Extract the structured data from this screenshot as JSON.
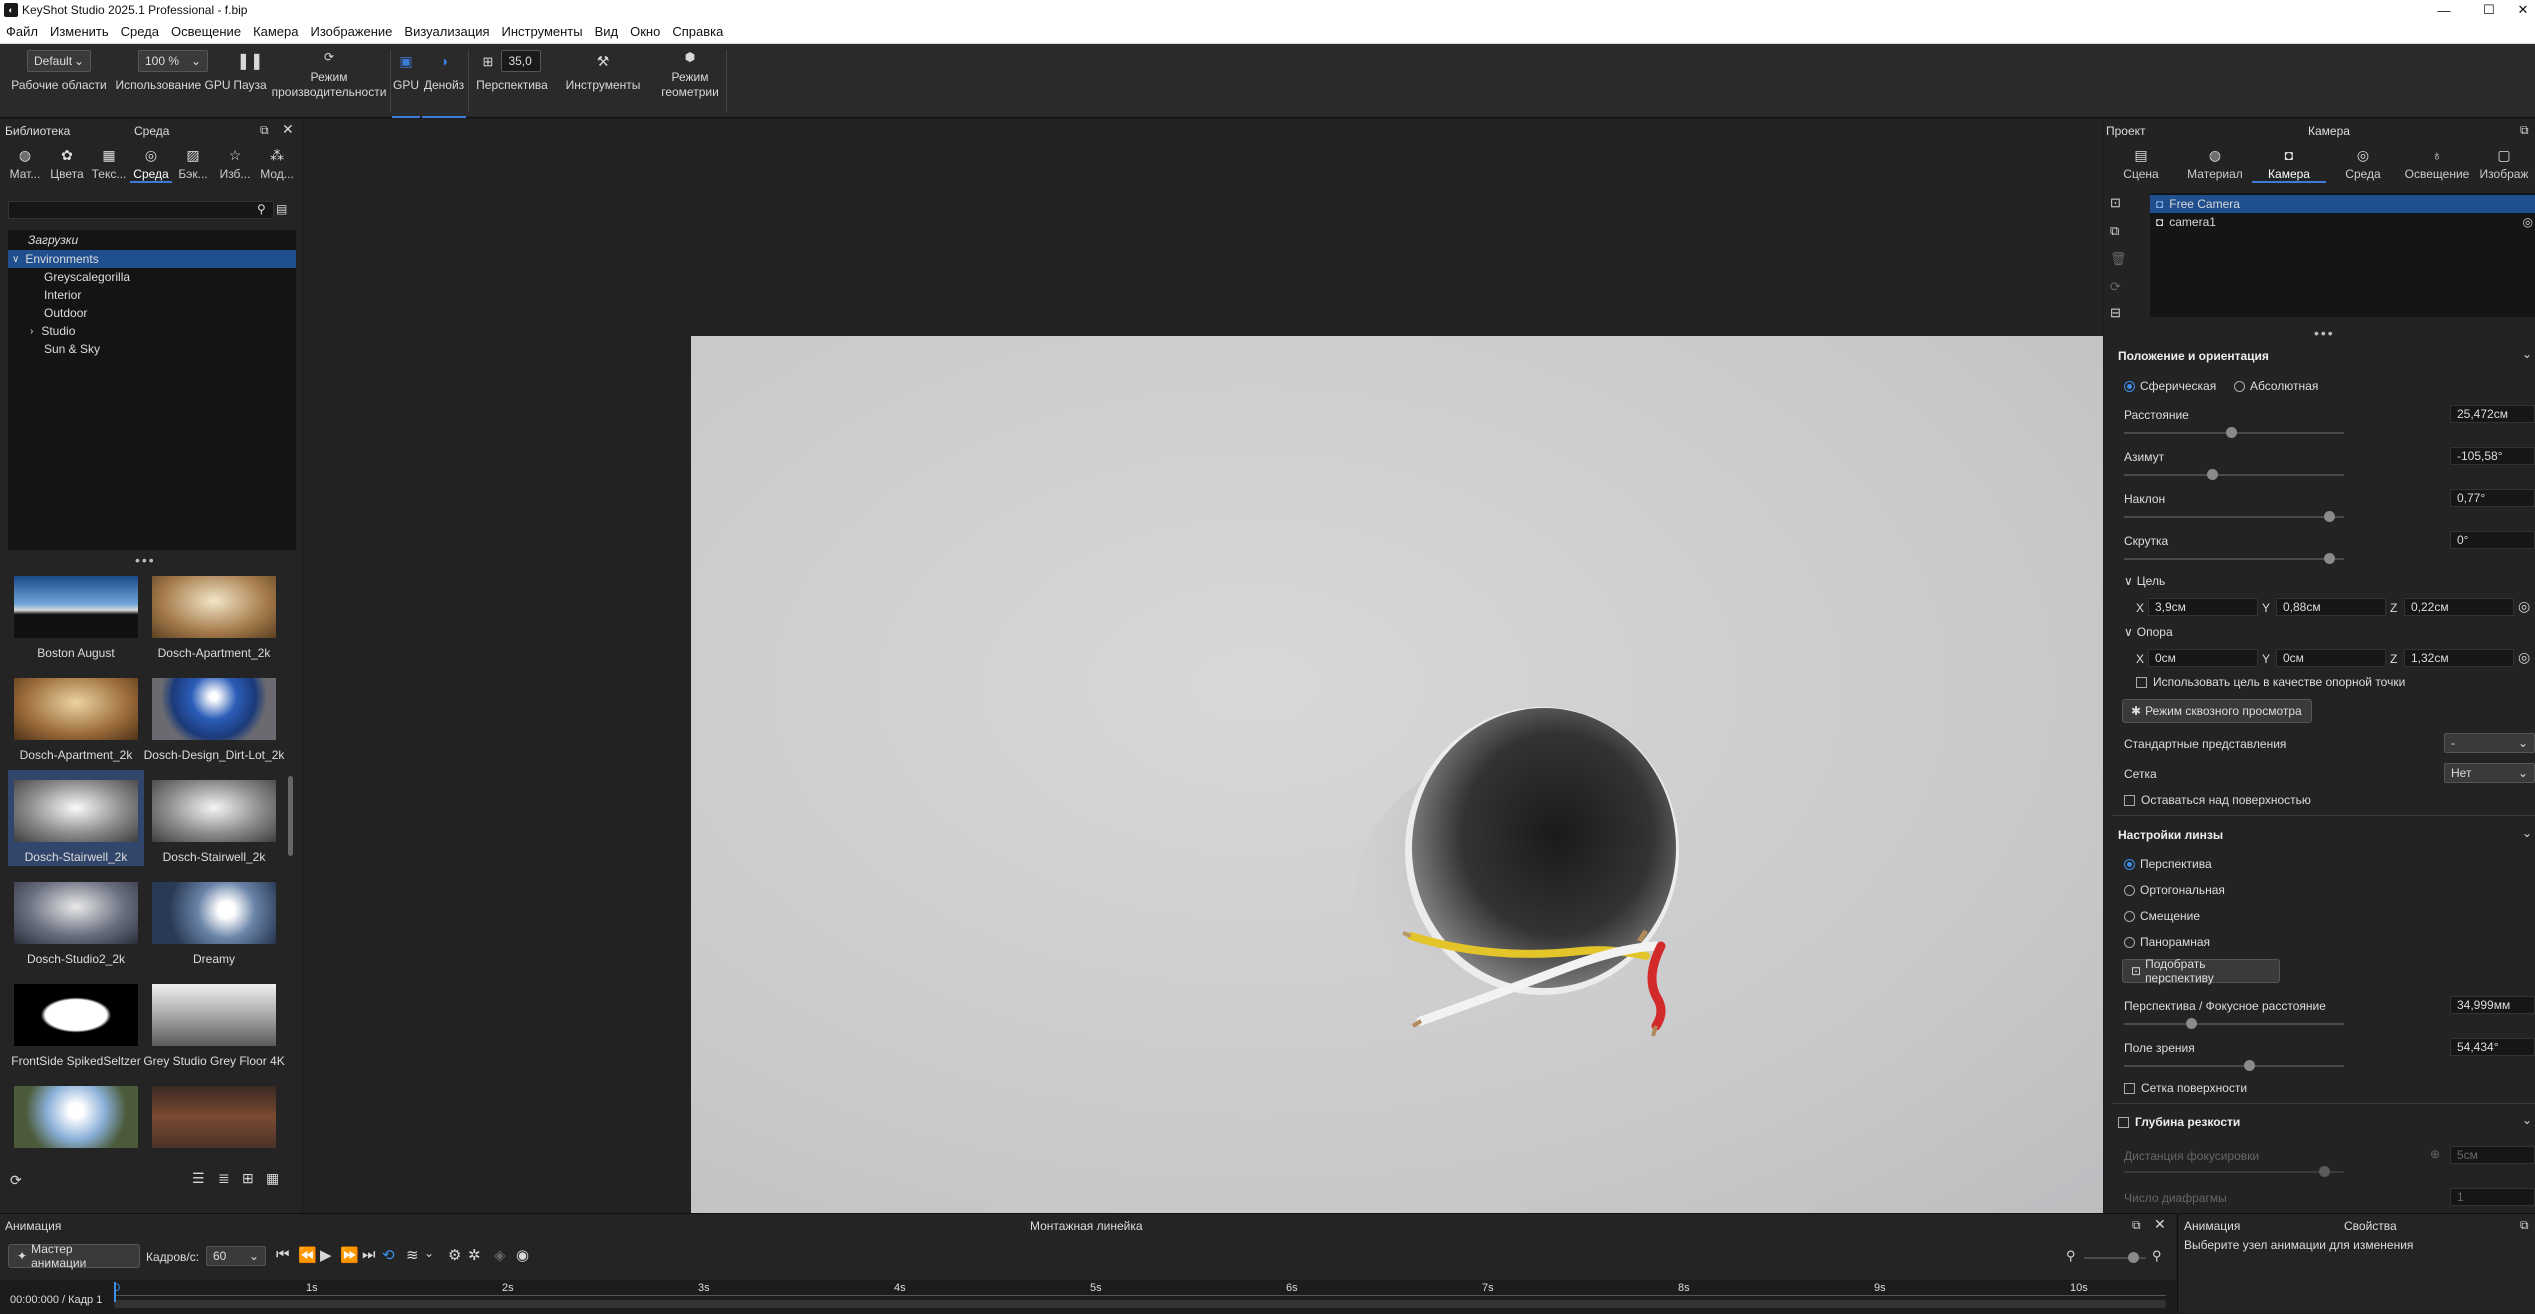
{
  "app": {
    "title": "KeyShot Studio 2025.1 Professional  - f.bip"
  },
  "menu": [
    "Файл",
    "Изменить",
    "Среда",
    "Освещение",
    "Камера",
    "Изображение",
    "Визуализация",
    "Инструменты",
    "Вид",
    "Окно",
    "Справка"
  ],
  "toolbar": {
    "workspace_value": "Default",
    "workspace_label": "Рабочие области",
    "gpu_usage_value": "100 %",
    "gpu_usage_label": "Использование GPU",
    "pause_label": "Пауза",
    "perf_label1": "Режим",
    "perf_label2": "производительности",
    "gpu_label": "GPU",
    "denoise_label": "Денойз",
    "fov_value": "35,0",
    "perspective_label": "Перспектива",
    "tools_label": "Инструменты",
    "geometry_label1": "Режим",
    "geometry_label2": "геометрии"
  },
  "left": {
    "header_library": "Библиотека",
    "header_env": "Среда",
    "tabs": [
      "Мат...",
      "Цвета",
      "Текс...",
      "Среда",
      "Бэк...",
      "Изб...",
      "Мод..."
    ],
    "tree": {
      "downloads": "Загрузки",
      "root": "Environments",
      "children": [
        "Greyscalegorilla",
        "Interior",
        "Outdoor",
        "Studio",
        "Sun & Sky"
      ]
    },
    "thumbs": [
      "Boston August",
      "Dosch-Apartment_2k",
      "Dosch-Apartment_2k",
      "Dosch-Design_Dirt-Lot_2k",
      "Dosch-Stairwell_2k",
      "Dosch-Stairwell_2k",
      "Dosch-Studio2_2k",
      "Dreamy",
      "FrontSide SpikedSeltzer",
      "Grey Studio Grey Floor 4K",
      "",
      ""
    ]
  },
  "right": {
    "header_project": "Проект",
    "header_camera": "Камера",
    "tabs": [
      "Сцена",
      "Материал",
      "Камера",
      "Среда",
      "Освещение",
      "Изображ"
    ],
    "cameras": [
      "Free Camera",
      "camera1"
    ],
    "pos_section": "Положение и ориентация",
    "spherical": "Сферическая",
    "absolute": "Абсолютная",
    "distance_label": "Расстояние",
    "distance_value": "25,472см",
    "azimuth_label": "Азимут",
    "azimuth_value": "-105,58°",
    "incline_label": "Наклон",
    "incline_value": "0,77°",
    "twist_label": "Скрутка",
    "twist_value": "0°",
    "target_label": "Цель",
    "target_x": "3,9см",
    "target_y": "0,88см",
    "target_z": "0,22см",
    "pivot_label": "Опора",
    "pivot_x": "0см",
    "pivot_y": "0см",
    "pivot_z": "1,32см",
    "use_target_pivot": "Использовать цель в качестве опорной точки",
    "walkthrough_btn": "Режим сквозного просмотра",
    "std_views_label": "Стандартные представления",
    "std_views_value": "-",
    "grid_label": "Сетка",
    "grid_value": "Нет",
    "stay_above": "Оставаться над поверхностью",
    "lens_section": "Настройки линзы",
    "lens_opts": [
      "Перспектива",
      "Ортогональная",
      "Смещение",
      "Панорамная"
    ],
    "match_persp_btn": "Подобрать перспективу",
    "focal_label": "Перспектива / Фокусное расстояние",
    "focal_value": "34,999мм",
    "fov_label": "Поле зрения",
    "fov_value": "54,434°",
    "surface_grid": "Сетка поверхности",
    "dof_section": "Глубина резкости",
    "focus_dist_label": "Дистанция фокусировки",
    "focus_dist_value": "5см",
    "fstop_label": "Число диафрагмы",
    "fstop_value": "1",
    "xl": "X",
    "yl": "Y",
    "zl": "Z"
  },
  "bottom": {
    "anim_header": "Анимация",
    "timeline_header": "Монтажная линейка",
    "wizard_btn": "Мастер анимации",
    "fps_label": "Кадров/с:",
    "fps_value": "60",
    "time_readout": "00:00:000 / Кадр 1",
    "ticks": [
      "0",
      "1s",
      "2s",
      "3s",
      "4s",
      "5s",
      "6s",
      "7s",
      "8s",
      "9s",
      "10s"
    ],
    "props_anim": "Анимация",
    "props_header": "Свойства",
    "props_hint": "Выберите узел анимации для изменения"
  },
  "colors": {
    "accent": "#3d7bd8",
    "selection": "#1f4f8f",
    "bg": "#1e1e1e",
    "panel": "#242424"
  }
}
